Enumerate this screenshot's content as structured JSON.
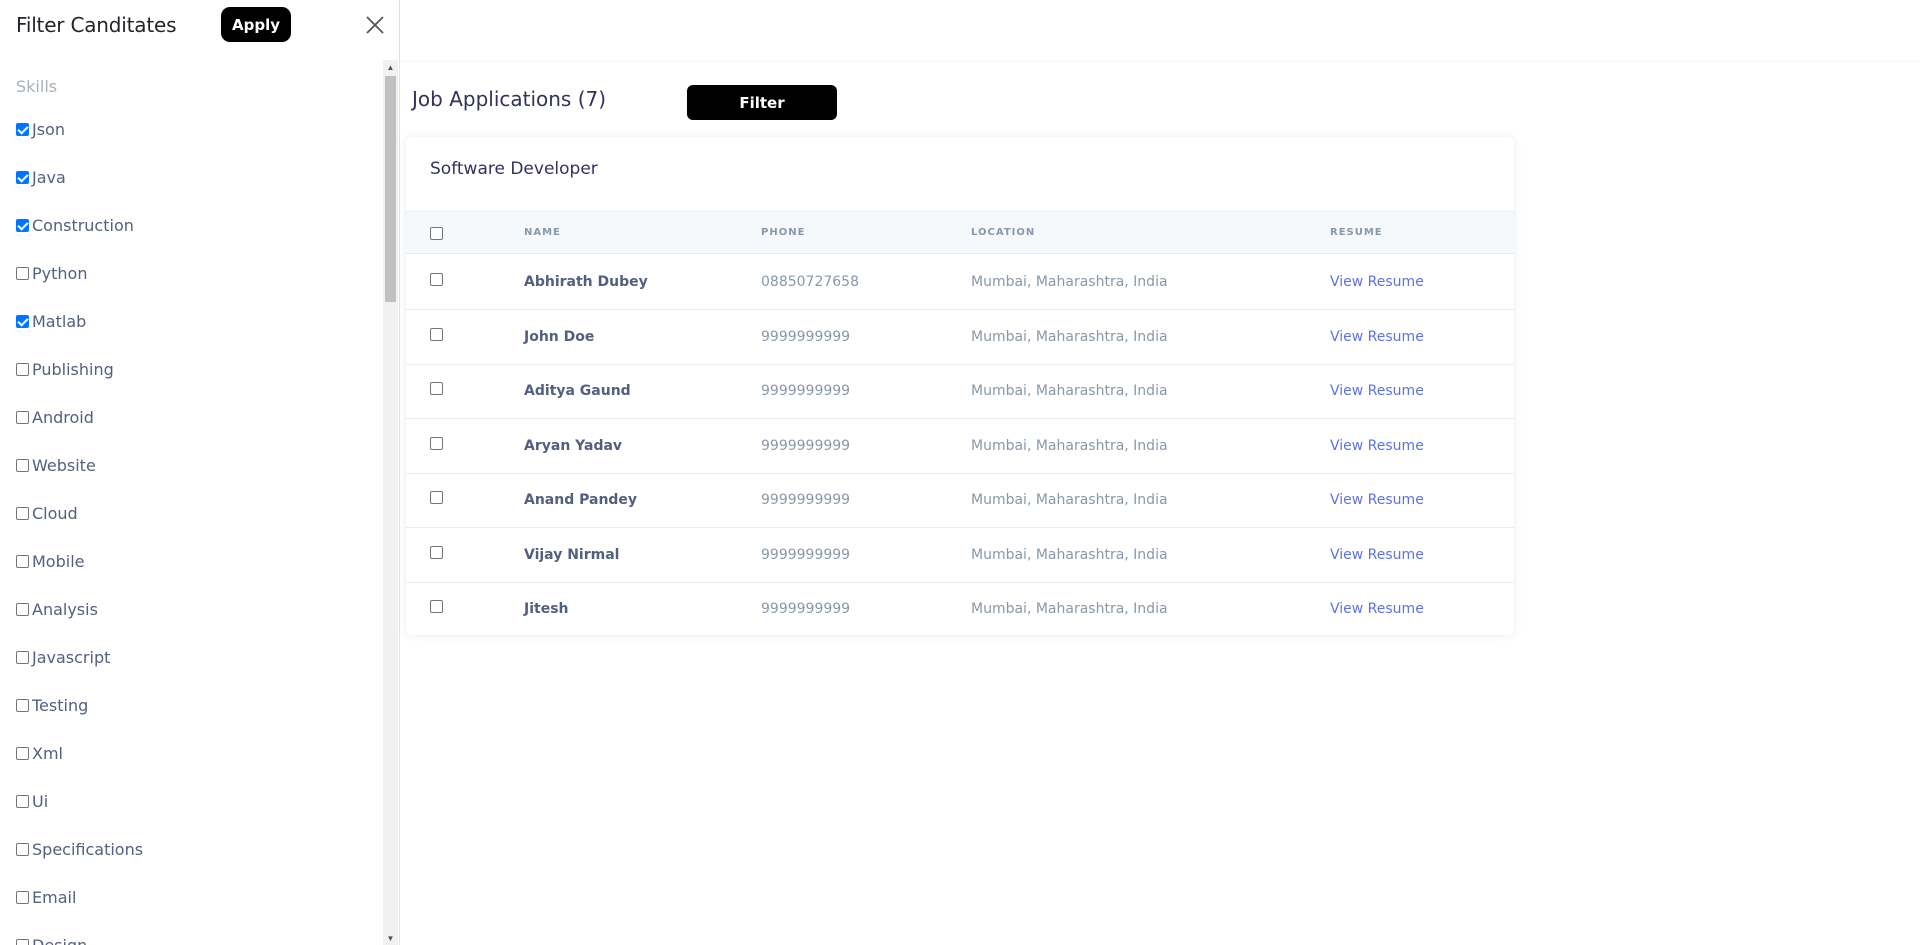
{
  "sidebar": {
    "title": "Filter Canditates",
    "apply_label": "Apply",
    "skills_heading": "Skills",
    "skills": [
      {
        "label": "Json",
        "checked": true
      },
      {
        "label": "Java",
        "checked": true
      },
      {
        "label": "Construction",
        "checked": true
      },
      {
        "label": "Python",
        "checked": false
      },
      {
        "label": "Matlab",
        "checked": true
      },
      {
        "label": "Publishing",
        "checked": false
      },
      {
        "label": "Android",
        "checked": false
      },
      {
        "label": "Website",
        "checked": false
      },
      {
        "label": "Cloud",
        "checked": false
      },
      {
        "label": "Mobile",
        "checked": false
      },
      {
        "label": "Analysis",
        "checked": false
      },
      {
        "label": "Javascript",
        "checked": false
      },
      {
        "label": "Testing",
        "checked": false
      },
      {
        "label": "Xml",
        "checked": false
      },
      {
        "label": "Ui",
        "checked": false
      },
      {
        "label": "Specifications",
        "checked": false
      },
      {
        "label": "Email",
        "checked": false
      },
      {
        "label": "Design",
        "checked": false
      }
    ]
  },
  "main": {
    "title": "Job Applications (7)",
    "filter_label": "Filter",
    "card_title": "Software Developer",
    "columns": {
      "name": "NAME",
      "phone": "PHONE",
      "location": "LOCATION",
      "resume": "RESUME"
    },
    "rows": [
      {
        "name": "Abhirath Dubey",
        "phone": "08850727658",
        "location": "Mumbai, Maharashtra, India",
        "resume": "View Resume"
      },
      {
        "name": "John Doe",
        "phone": "9999999999",
        "location": "Mumbai, Maharashtra, India",
        "resume": "View Resume"
      },
      {
        "name": "Aditya Gaund",
        "phone": "9999999999",
        "location": "Mumbai, Maharashtra, India",
        "resume": "View Resume"
      },
      {
        "name": "Aryan Yadav",
        "phone": "9999999999",
        "location": "Mumbai, Maharashtra, India",
        "resume": "View Resume"
      },
      {
        "name": "Anand Pandey",
        "phone": "9999999999",
        "location": "Mumbai, Maharashtra, India",
        "resume": "View Resume"
      },
      {
        "name": "Vijay Nirmal",
        "phone": "9999999999",
        "location": "Mumbai, Maharashtra, India",
        "resume": "View Resume"
      },
      {
        "name": "Jitesh",
        "phone": "9999999999",
        "location": "Mumbai, Maharashtra, India",
        "resume": "View Resume"
      }
    ]
  },
  "colors": {
    "accent": "#5e72e4",
    "button_bg": "#000000",
    "checkbox_checked": "#0075ff"
  }
}
